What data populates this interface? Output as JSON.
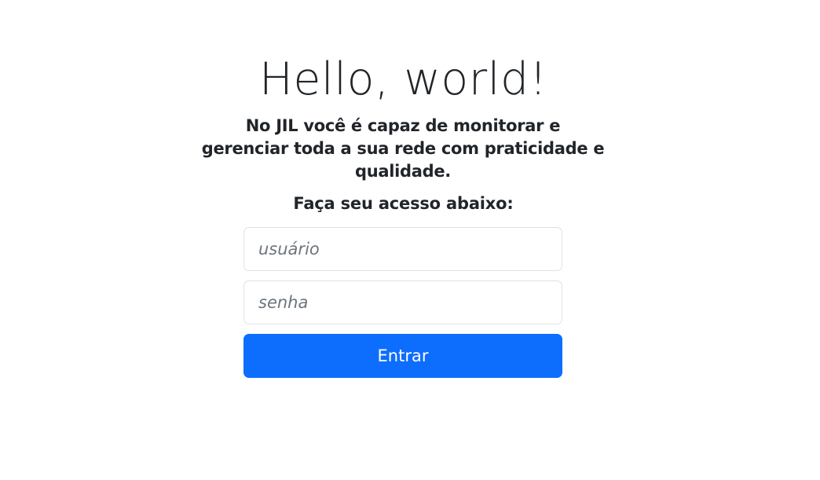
{
  "header": {
    "title": "Hello, world!",
    "subtitle": "No JIL você é capaz de monitorar e gerenciar toda a sua rede com praticidade e qualidade."
  },
  "login": {
    "prompt": "Faça seu acesso abaixo:",
    "username_placeholder": "usuário",
    "password_placeholder": "senha",
    "submit_label": "Entrar",
    "accent_color": "#0d6efd"
  }
}
